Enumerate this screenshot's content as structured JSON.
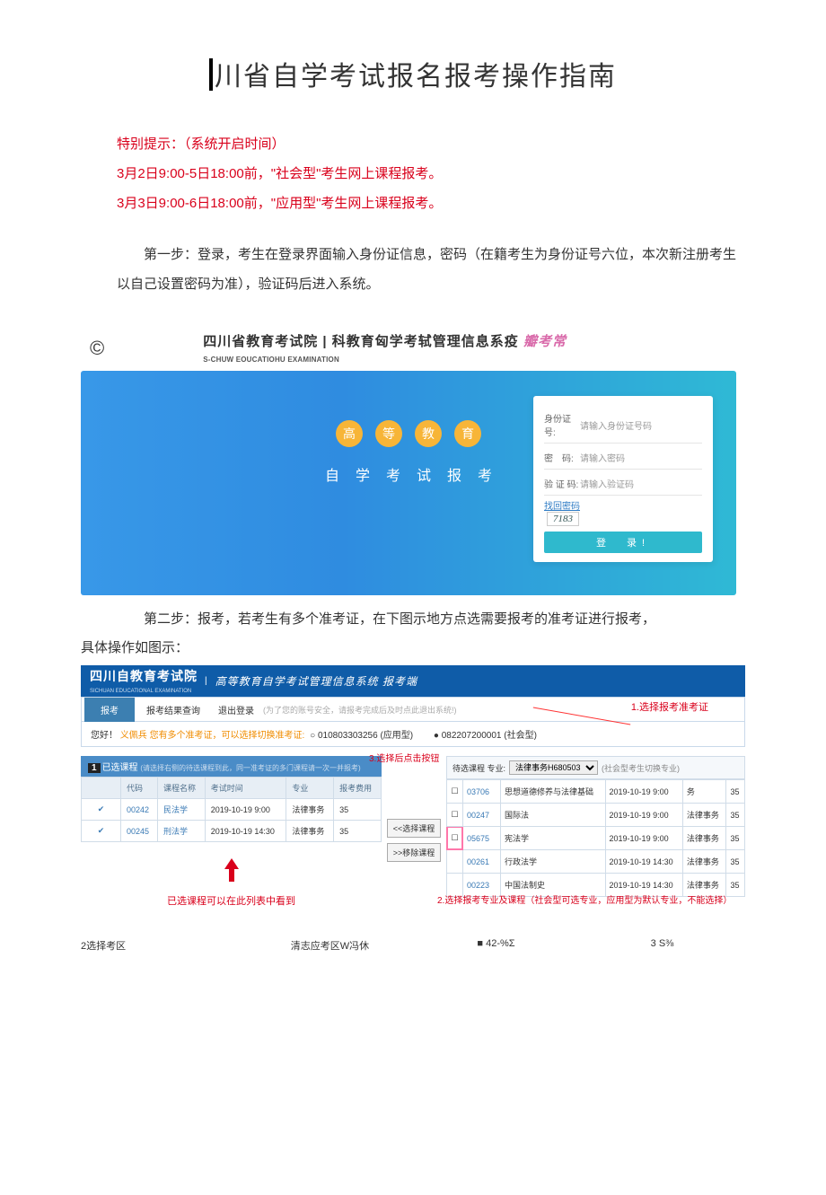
{
  "title_prefix_bar": "|",
  "title": "川省自学考试报名报考操作指南",
  "warn_line": "特别提示：（系统开启时间）",
  "time_lines": [
    "3月2日9:00-5日18:00前，\"社会型\"考生网上课程报考。",
    "3月3日9:00-6日18:00前，\"应用型\"考生网上课程报考。"
  ],
  "step1": "第一步：登录，考生在登录界面输入身份证信息，密码（在籍考生为身份证号六位，本次新注册考生以自己设置密码为准），验证码后进入系统。",
  "fig1": {
    "copyright": "©",
    "head_main": "四川省教育考试院 | 科教育匈学考轼管理信息系疫",
    "head_pink": "瓣考常",
    "head_sub": "S-CHUW EOUCATIOHU EXAMINATION",
    "circles": [
      "高",
      "等",
      "教",
      "育"
    ],
    "banner_sub": "自学考试报考",
    "form": {
      "id_label": "身份证号:",
      "id_ph": "请输入身份证号码",
      "pw_label": "密　码:",
      "pw_ph": "请输入密码",
      "cap_label": "验 证 码:",
      "cap_ph": "请输入验证码",
      "forgot": "找回密码",
      "captcha": "7183",
      "login": "登　录!"
    }
  },
  "step2": "第二步：报考，若考生有多个准考证，在下图示地方点选需要报考的准考证进行报考，",
  "step2_note": "具体操作如图示：",
  "fig2": {
    "logo": "四川自教育考试院",
    "sublogo": "SICHUAN EDUCATIONAL EXAMINATION",
    "title2": "高等教育自学考试管理信息系统 报考端",
    "menu": {
      "active": "报考",
      "item2": "报考结果查询",
      "item3": "退出登录",
      "hint": "(为了您的账号安全，请报考完成后及时点此退出系统!)"
    },
    "anno1": "1.选择报考准考证",
    "id_row": {
      "hello": "您好！",
      "name": "义佩兵",
      "note": "您有多个准考证，可以选择切换准考证:",
      "r1": "○ 010803303256 (应用型)",
      "r2": "● 082207200001 (社会型)"
    },
    "left": {
      "sec_num": "1",
      "sec_title": "已选课程",
      "sec_hint": "(请选择右侧的待选课程到此，同一准考证的多门课程请一次一并报考)",
      "cols": [
        "",
        "代码",
        "课程名称",
        "考试时间",
        "专业",
        "报考费用"
      ],
      "rows": [
        [
          "✔",
          "00242",
          "民法学",
          "2019-10-19 9:00",
          "法律事务",
          "35"
        ],
        [
          "✔",
          "00245",
          "刑法学",
          "2019-10-19 14:30",
          "法律事务",
          "35"
        ]
      ],
      "note": "已选课程可以在此列表中看到"
    },
    "mid": {
      "anno": "3.选择后点击按钮",
      "b1": "<<选择课程",
      "b2": ">>移除课程"
    },
    "right": {
      "label": "待选课程 专业:",
      "select_val": "法律事务H680503",
      "switch": "(社会型考生切换专业)",
      "rows": [
        {
          "ck": "☐",
          "code": "03706",
          "name": "思想道德修养与法律基础",
          "time": "2019-10-19 9:00",
          "col5": "务",
          "fee": "35",
          "pink": false
        },
        {
          "ck": "☐",
          "code": "00247",
          "name": "国际法",
          "time": "2019-10-19 9:00",
          "col5": "法律事务",
          "fee": "35",
          "pink": false
        },
        {
          "ck": "☐",
          "code": "05675",
          "name": "宪法学",
          "time": "2019-10-19 9:00",
          "col5": "法律事务",
          "fee": "35",
          "pink": true
        },
        {
          "ck": "",
          "code": "00261",
          "name": "行政法学",
          "time": "2019-10-19 14:30",
          "col5": "法律事务",
          "fee": "35",
          "pink": false
        },
        {
          "ck": "",
          "code": "00223",
          "name": "中国法制史",
          "time": "2019-10-19 14:30",
          "col5": "法律事务",
          "fee": "35",
          "pink": false
        }
      ],
      "anno2": "2.选择报考专业及课程（社会型可选专业，应用型为默认专业，不能选择）"
    }
  },
  "foot": {
    "c1": "2选择考区",
    "c2": "清志应考区W冯休",
    "c3": "■ 42-%Σ",
    "c4": "3 S⅜"
  }
}
